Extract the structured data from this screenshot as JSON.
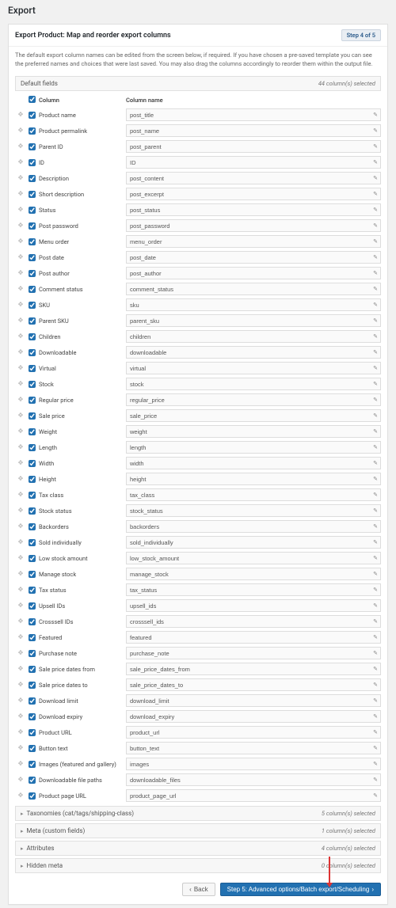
{
  "page_title": "Export",
  "panel": {
    "title": "Export Product: Map and reorder export columns",
    "step_badge": "Step 4 of 5",
    "description": "The default export column names can be edited from the screen below, if required. If you have chosen a pre-saved template you can see the preferred names and choices that were last saved. You may also drag the columns accordingly to reorder them within the output file."
  },
  "default_fields": {
    "label": "Default fields",
    "count_text": "44 column(s) selected",
    "head_col": "Column",
    "head_name": "Column name"
  },
  "rows": [
    {
      "label": "Product name",
      "name": "post_title"
    },
    {
      "label": "Product permalink",
      "name": "post_name"
    },
    {
      "label": "Parent ID",
      "name": "post_parent"
    },
    {
      "label": "ID",
      "name": "ID"
    },
    {
      "label": "Description",
      "name": "post_content"
    },
    {
      "label": "Short description",
      "name": "post_excerpt"
    },
    {
      "label": "Status",
      "name": "post_status"
    },
    {
      "label": "Post password",
      "name": "post_password"
    },
    {
      "label": "Menu order",
      "name": "menu_order"
    },
    {
      "label": "Post date",
      "name": "post_date"
    },
    {
      "label": "Post author",
      "name": "post_author"
    },
    {
      "label": "Comment status",
      "name": "comment_status"
    },
    {
      "label": "SKU",
      "name": "sku"
    },
    {
      "label": "Parent SKU",
      "name": "parent_sku"
    },
    {
      "label": "Children",
      "name": "children"
    },
    {
      "label": "Downloadable",
      "name": "downloadable"
    },
    {
      "label": "Virtual",
      "name": "virtual"
    },
    {
      "label": "Stock",
      "name": "stock"
    },
    {
      "label": "Regular price",
      "name": "regular_price"
    },
    {
      "label": "Sale price",
      "name": "sale_price"
    },
    {
      "label": "Weight",
      "name": "weight"
    },
    {
      "label": "Length",
      "name": "length"
    },
    {
      "label": "Width",
      "name": "width"
    },
    {
      "label": "Height",
      "name": "height"
    },
    {
      "label": "Tax class",
      "name": "tax_class"
    },
    {
      "label": "Stock status",
      "name": "stock_status"
    },
    {
      "label": "Backorders",
      "name": "backorders"
    },
    {
      "label": "Sold individually",
      "name": "sold_individually"
    },
    {
      "label": "Low stock amount",
      "name": "low_stock_amount"
    },
    {
      "label": "Manage stock",
      "name": "manage_stock"
    },
    {
      "label": "Tax status",
      "name": "tax_status"
    },
    {
      "label": "Upsell IDs",
      "name": "upsell_ids"
    },
    {
      "label": "Crosssell IDs",
      "name": "crosssell_ids"
    },
    {
      "label": "Featured",
      "name": "featured"
    },
    {
      "label": "Purchase note",
      "name": "purchase_note"
    },
    {
      "label": "Sale price dates from",
      "name": "sale_price_dates_from"
    },
    {
      "label": "Sale price dates to",
      "name": "sale_price_dates_to"
    },
    {
      "label": "Download limit",
      "name": "download_limit"
    },
    {
      "label": "Download expiry",
      "name": "download_expiry"
    },
    {
      "label": "Product URL",
      "name": "product_url"
    },
    {
      "label": "Button text",
      "name": "button_text"
    },
    {
      "label": "Images (featured and gallery)",
      "name": "images"
    },
    {
      "label": "Downloadable file paths",
      "name": "downloadable_files"
    },
    {
      "label": "Product page URL",
      "name": "product_page_url"
    }
  ],
  "sections": [
    {
      "title": "Taxonomies (cat/tags/shipping-class)",
      "count": "5 column(s) selected"
    },
    {
      "title": "Meta (custom fields)",
      "count": "1 column(s) selected"
    },
    {
      "title": "Attributes",
      "count": "4 column(s) selected"
    },
    {
      "title": "Hidden meta",
      "count": "0 column(s) selected"
    }
  ],
  "footer": {
    "back": "Back",
    "next": "Step 5: Advanced options/Batch export/Scheduling"
  }
}
